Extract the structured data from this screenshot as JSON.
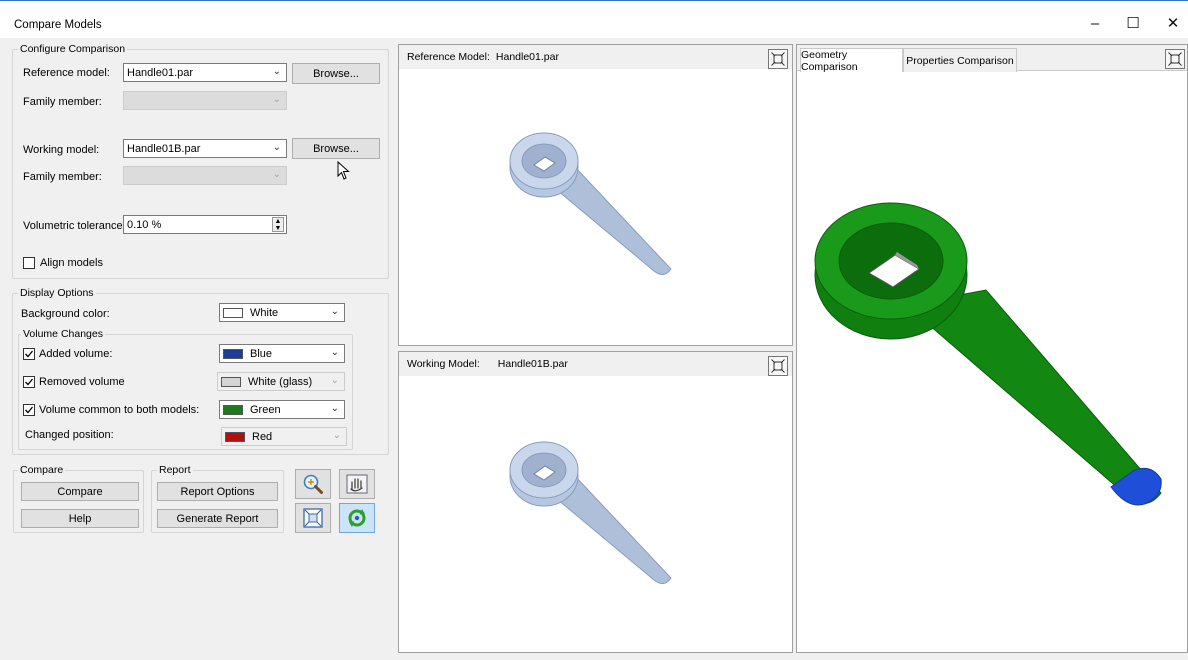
{
  "window": {
    "title": "Compare Models",
    "minimize": "–",
    "maximize": "☐",
    "close": "✕"
  },
  "configure": {
    "legend": "Configure Comparison",
    "reference_label": "Reference model:",
    "reference_value": "Handle01.par",
    "family_label_1": "Family member:",
    "working_label": "Working model:",
    "working_value": "Handle01B.par",
    "family_label_2": "Family member:",
    "browse_label": "Browse...",
    "tolerance_label": "Volumetric tolerance:",
    "tolerance_value": "0.10 %",
    "align_label": "Align models",
    "align_checked": false
  },
  "display": {
    "legend": "Display Options",
    "background_label": "Background color:",
    "background_value": "White",
    "volume_legend": "Volume Changes",
    "added_label": "Added volume:",
    "added_value": "Blue",
    "removed_label": "Removed volume",
    "removed_value": "White (glass)",
    "common_label": "Volume common to both models:",
    "common_value": "Green",
    "changed_label": "Changed position:",
    "changed_value": "Red"
  },
  "compare": {
    "legend": "Compare",
    "compare_button": "Compare",
    "help_button": "Help"
  },
  "report": {
    "legend": "Report",
    "options_button": "Report Options",
    "generate_button": "Generate Report"
  },
  "reference_view": {
    "label": "Reference Model:",
    "file": "Handle01.par"
  },
  "working_view": {
    "label": "Working Model:",
    "file": "Handle01B.par"
  },
  "tabs": {
    "geometry": "Geometry Comparison",
    "properties": "Properties Comparison"
  },
  "colors": {
    "white": "#ffffff",
    "blue": "#1c3f94",
    "glass": "#d4d4d4",
    "green": "#1e7a1e",
    "red": "#b01010",
    "part_light": "#c4d4ea",
    "part_green": "#149114",
    "part_blue": "#1f4fd8"
  }
}
